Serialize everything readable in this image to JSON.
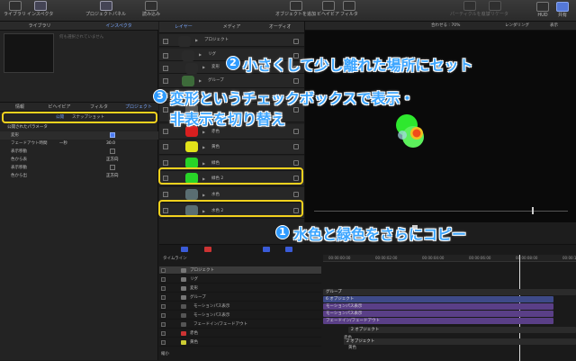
{
  "toolbar": {
    "library": "ライブラリ",
    "inspector": "インスペクタ",
    "project_panel": "プロジェクトパネル",
    "import": "読み込み",
    "add_object": "オブジェクトを追加",
    "behavior": "ビヘイビア",
    "filter": "フィルタ",
    "particle": "パーティクルを追加",
    "replicator": "リプリケータ",
    "hud": "HUD",
    "share": "共有"
  },
  "left": {
    "tabs": [
      "ライブラリ",
      "インスペクタ"
    ],
    "no_image": "何も選択されていません",
    "inspector_tabs": [
      "情報",
      "ビヘイビア",
      "フィルタ",
      "プロジェクト"
    ],
    "sub_tabs": [
      "公開",
      "スナップショット"
    ],
    "section_title": "公開されたパラメータ",
    "params": [
      {
        "label": "変形",
        "value": "",
        "checkbox": true,
        "checked": true
      },
      {
        "label": "フェードアウト時間",
        "value": "30.0",
        "prefix": "一秒"
      },
      {
        "label": "表示移動",
        "value": "",
        "checkbox": true,
        "checked": false
      },
      {
        "label": "色から表",
        "value": "正方向"
      },
      {
        "label": "表示移動",
        "value": "",
        "checkbox": true,
        "checked": false
      },
      {
        "label": "色から出",
        "value": "正方向"
      }
    ]
  },
  "layers_panel": {
    "tabs": [
      "レイヤー",
      "メディア",
      "オーディオ"
    ],
    "rows": [
      {
        "name": "プロジェクト",
        "swatch": "#2a2a2a",
        "indent": 0
      },
      {
        "name": "リグ",
        "swatch": "#2a2a2a",
        "indent": 1
      },
      {
        "name": "変形",
        "swatch": "#2a2a2a",
        "indent": 2
      },
      {
        "name": "グループ",
        "swatch": "#3d6b3a",
        "indent": 1
      },
      {
        "name": "",
        "swatch": "#555555",
        "indent": 2
      },
      {
        "name": "",
        "swatch": "#555555",
        "indent": 2
      },
      {
        "name": "赤色",
        "swatch": "#d81f1f",
        "indent": 2
      },
      {
        "name": "黄色",
        "swatch": "#e2e31a",
        "indent": 2
      },
      {
        "name": "緑色",
        "swatch": "#28d428",
        "indent": 2
      },
      {
        "name": "緑色 2",
        "swatch": "#28d428",
        "indent": 2
      },
      {
        "name": "水色",
        "swatch": "#5a6e72",
        "indent": 2
      },
      {
        "name": "水色 2",
        "swatch": "#5a6e72",
        "indent": 2
      }
    ]
  },
  "canvas": {
    "zoom_label": "合わせる : 70%",
    "render": "レンダリング",
    "view": "表示"
  },
  "timeline": {
    "title": "タイムライン",
    "rows": [
      {
        "name": "プロジェクト",
        "icon_color": "#777"
      },
      {
        "name": "リグ",
        "icon_color": "#777"
      },
      {
        "name": "変形",
        "icon_color": "#777"
      },
      {
        "name": "グループ",
        "icon_color": "#777"
      },
      {
        "name": "モーションパス表示",
        "icon_color": "#555"
      },
      {
        "name": "モーションパス表示",
        "icon_color": "#555"
      },
      {
        "name": "フェードイン/フェードアウト",
        "icon_color": "#555"
      },
      {
        "name": "赤色",
        "icon_color": "#c33"
      },
      {
        "name": "黄色",
        "icon_color": "#cc3"
      }
    ],
    "ruler": [
      "00:00:00:00",
      "00:00:02:00",
      "00:00:04:00",
      "00:00:06:00",
      "00:00:08:00",
      "00:00:10:00"
    ],
    "bars": [
      {
        "label": "グループ",
        "color": "#2b2b2b"
      },
      {
        "label": "6 オブジェクト",
        "color": "#3e4a88"
      },
      {
        "label": "モーションパス表示",
        "color": "#5a3f87"
      },
      {
        "label": "モーションパス表示",
        "color": "#5a3f87"
      },
      {
        "label": "フェードイン/フェードアウト",
        "color": "#5a3f87"
      },
      {
        "label": "2 オブジェクト",
        "color": "#2b2b2b"
      },
      {
        "label": "2 オブジェクト",
        "color": "#2b2b2b"
      }
    ],
    "small_labels": [
      "赤色",
      "黄色"
    ],
    "zoom": "縮小"
  },
  "annotations": {
    "a1": {
      "num": "1",
      "text": "水色と緑色をさらにコピー"
    },
    "a2": {
      "num": "2",
      "text": "小さくして少し離れた場所にセット"
    },
    "a3": {
      "num": "3",
      "line1": "変形というチェックボックスで表示・",
      "line2": "非表示を切り替え"
    }
  },
  "colors": {
    "accent": "#4d7cf4",
    "highlight": "#f4d21e",
    "annotation": "#3ea6ff"
  }
}
